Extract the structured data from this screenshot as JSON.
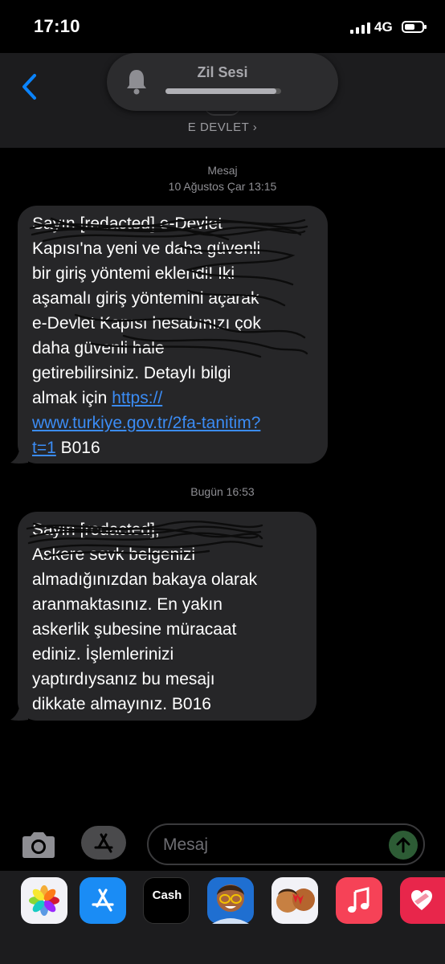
{
  "status_bar": {
    "time": "17:10",
    "network": "4G",
    "signal_bars": 4,
    "battery_level": 0.55
  },
  "nav": {
    "contact_name": "E DEVLET ›",
    "hud": {
      "label": "Zil Sesi",
      "volume_level": 0.96
    }
  },
  "conversation": {
    "thread_label": "Mesaj",
    "messages": [
      {
        "timestamp": "10 Ağustos Çar 13:15",
        "text": "Sayın [redacted] e-Devlet\nKapısı'na yeni ve daha güvenli\nbir giriş yöntemi eklendi! İki\naşamalı giriş yöntemini açarak\ne-Devlet Kapısı hesabınızı çok\ndaha güvenli hale\ngetirebilirsiniz. Detaylı bilgi\nalmak için ",
        "link_text": "https://\nwww.turkiye.gov.tr/2fa-tanitim?\nt=1",
        "suffix": " B016"
      },
      {
        "timestamp": "Bugün 16:53",
        "text": "Sayın [redacted],\nAskere sevk belgenizi\nalmadığınızdan bakaya olarak\naranmaktasınız. En yakın\naskerlik şubesine müracaat\nediniz. İşlemlerinizi\nyaptırdıysanız bu mesajı\ndikkate almayınız. B016"
      }
    ]
  },
  "composer": {
    "placeholder": "Mesaj"
  },
  "app_strip": {
    "cash_label": "Cash"
  },
  "colors": {
    "link": "#3b8cf5",
    "bubble": "#262628",
    "back_chevron": "#0a84ff",
    "send": "#2d5c35"
  }
}
